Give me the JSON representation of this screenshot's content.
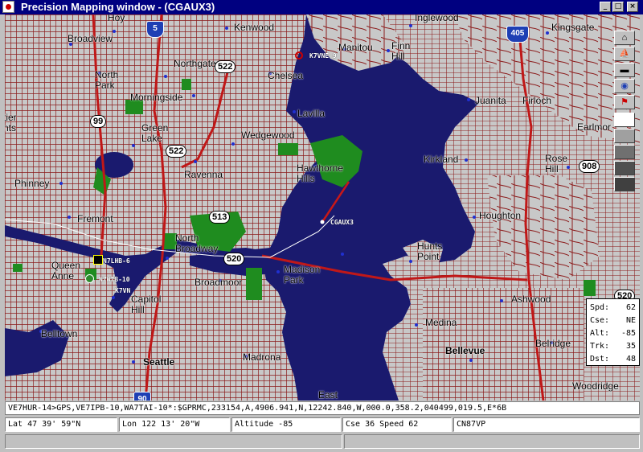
{
  "window": {
    "title": "Precision Mapping window - (CGAUX3)",
    "controls": {
      "minimize": "_",
      "maximize": "□",
      "close": "×"
    }
  },
  "colors": {
    "water": "#1a1a6e",
    "land": "#c8c8c8",
    "streets": "#8c1c1c",
    "parks": "#1f8c1f",
    "titlebar": "#000080"
  },
  "map": {
    "places": [
      {
        "text": "Hoy"
      },
      {
        "text": "Broadview"
      },
      {
        "text": "Northgate"
      },
      {
        "text": "North"
      },
      {
        "text": "Park"
      },
      {
        "text": "Kenwood"
      },
      {
        "text": "Chelsea"
      },
      {
        "text": "Manitou"
      },
      {
        "text": "Finn"
      },
      {
        "text": "Hill"
      },
      {
        "text": "Inglewood"
      },
      {
        "text": "Kingsgate"
      },
      {
        "text": "Juanita"
      },
      {
        "text": "Firloch"
      },
      {
        "text": "Earlmor"
      },
      {
        "text": "Morningside"
      },
      {
        "text": "Lavilla"
      },
      {
        "text": "Green"
      },
      {
        "text": "Lake"
      },
      {
        "text": "Wedgewood"
      },
      {
        "text": "Hawthorne"
      },
      {
        "text": "Hills"
      },
      {
        "text": "Ravenna"
      },
      {
        "text": "Kirkland"
      },
      {
        "text": "Rose"
      },
      {
        "text": "Hill"
      },
      {
        "text": "Phinney"
      },
      {
        "text": "Fremont"
      },
      {
        "text": "Houghton"
      },
      {
        "text": "North"
      },
      {
        "text": "Broadway"
      },
      {
        "text": "Hunts"
      },
      {
        "text": "Point"
      },
      {
        "text": "Queen"
      },
      {
        "text": "Anne"
      },
      {
        "text": "Madison"
      },
      {
        "text": "Park"
      },
      {
        "text": "Broadmoor"
      },
      {
        "text": "Capitol"
      },
      {
        "text": "Hill"
      },
      {
        "text": "Ashwood"
      },
      {
        "text": "Medina"
      },
      {
        "text": "Belltown"
      },
      {
        "text": "Bellevue"
      },
      {
        "text": "Belridge"
      },
      {
        "text": "Madrona"
      },
      {
        "text": "Seattle"
      },
      {
        "text": "East"
      },
      {
        "text": "Woodridge"
      },
      {
        "text": "tier"
      },
      {
        "text": "nts"
      }
    ],
    "highways": [
      {
        "text": "522"
      },
      {
        "text": "99"
      },
      {
        "text": "522"
      },
      {
        "text": "513"
      },
      {
        "text": "520"
      },
      {
        "text": "908"
      },
      {
        "text": "520"
      }
    ],
    "interstates": [
      {
        "text": "5"
      },
      {
        "text": "405"
      },
      {
        "text": "90"
      }
    ],
    "stations": [
      {
        "text": "K7VNE-9"
      },
      {
        "text": "CGAUX3"
      },
      {
        "text": "N7LHB-6"
      },
      {
        "text": "N7WTB-10"
      },
      {
        "text": "K7VN"
      }
    ]
  },
  "toolbar": {
    "icons": [
      "house-icon",
      "boat-icon",
      "car-icon",
      "globe-icon",
      "flag-icon",
      "shade-white-icon",
      "shade-gray-icon",
      "shade-dark-icon",
      "shade-darker-icon",
      "shade-darkest-icon"
    ]
  },
  "info": {
    "rows": [
      {
        "label": "Spd:",
        "value": "62"
      },
      {
        "label": "Cse:",
        "value": "NE"
      },
      {
        "label": "Alt:",
        "value": "-85"
      },
      {
        "label": "Trk:",
        "value": "35"
      },
      {
        "label": "Dst:",
        "value": "48"
      }
    ]
  },
  "packet": "VE7HUR-14>GPS,VE7IPB-10,WA7TAI-10*:$GPRMC,233154,A,4906.941,N,12242.840,W,000.0,358.2,040499,019.5,E*6B",
  "status": {
    "lat": "Lat  47 39' 59\"N",
    "lon": "Lon 122 13' 20\"W",
    "altitude": "Altitude -85",
    "course_speed": "Cse 36 Speed 62",
    "grid": "CN87VP"
  }
}
